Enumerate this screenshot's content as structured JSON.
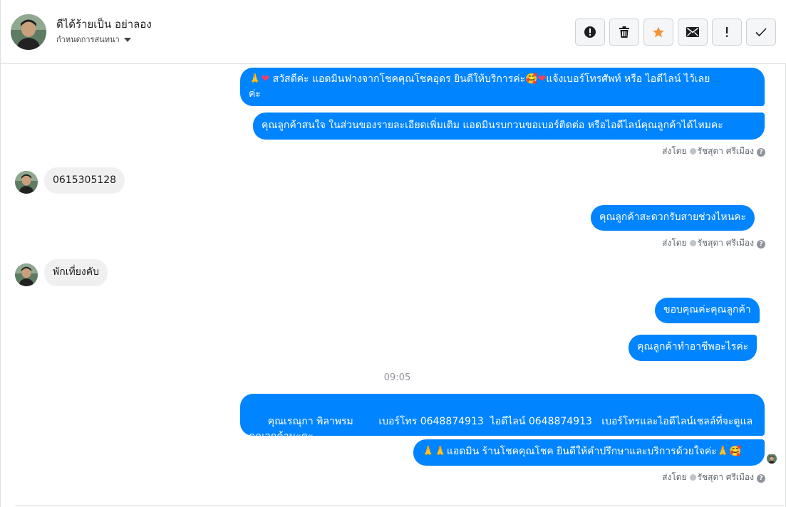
{
  "header": {
    "contact_name": "ดีได้ร้ายเป็น อย่าลอง",
    "assign_label": "กำหนดการสนทนา",
    "actions": [
      {
        "icon": "alert-circle-icon"
      },
      {
        "icon": "trash-icon"
      },
      {
        "icon": "star-icon",
        "color": "#f7923b"
      },
      {
        "icon": "mail-icon"
      },
      {
        "icon": "exclamation-icon"
      },
      {
        "icon": "check-icon"
      }
    ]
  },
  "messages": {
    "m1_text": "สวัสดีค่ะ แอดมินฟางจากโชคคุณโชคอุดร ยินดีให้บริการค่ะ",
    "m1_text2": "แจ้งเบอร์โทรศัพท์ หรือ ไอดีไลน์  ไว้เลย",
    "m1_text3": "ค่ะ",
    "m2_text": "คุณลูกค้าสนใจ ในส่วนของรายละเอียดเพิ่มเติม แอดมินรบกวนขอเบอร์ติดต่อ หรือไอดีไลน์คุณลูกค้าได้ไหมคะ",
    "sent_by_prefix": "ส่งโดย",
    "sent_by_name": "รัชสุดา ศรีเมือง",
    "in1_text": "0615305128",
    "m3_text": "คุณลูกค้าสะดวกรับสายช่วงไหนคะ",
    "in2_text": "พักเที่ยงคับ",
    "m4_text": "ขอบคุณค่ะคุณลูกค้า",
    "m5_text": "คุณลูกค้าทำอาชีพอะไรค่ะ",
    "time_divider": "09:05",
    "m6_line1": "คุณเรณุกา พิลาพรม        เบอร์โทร 0648874913  ไอดีไลน์ 0648874913   เบอร์โทรและไอดีไลน์เชลล์ที่จะดูแล",
    "m6_line2": "คุณลูกค้านะคะ",
    "m7_text": "แอดมิน ร้านโชคคุณโชค ยินดีให้คำปรึกษาและบริการด้วยใจค่ะ"
  },
  "colors": {
    "bubble_outgoing": "#0084ff",
    "bubble_incoming": "#f1f0f0",
    "star": "#f7923b"
  }
}
